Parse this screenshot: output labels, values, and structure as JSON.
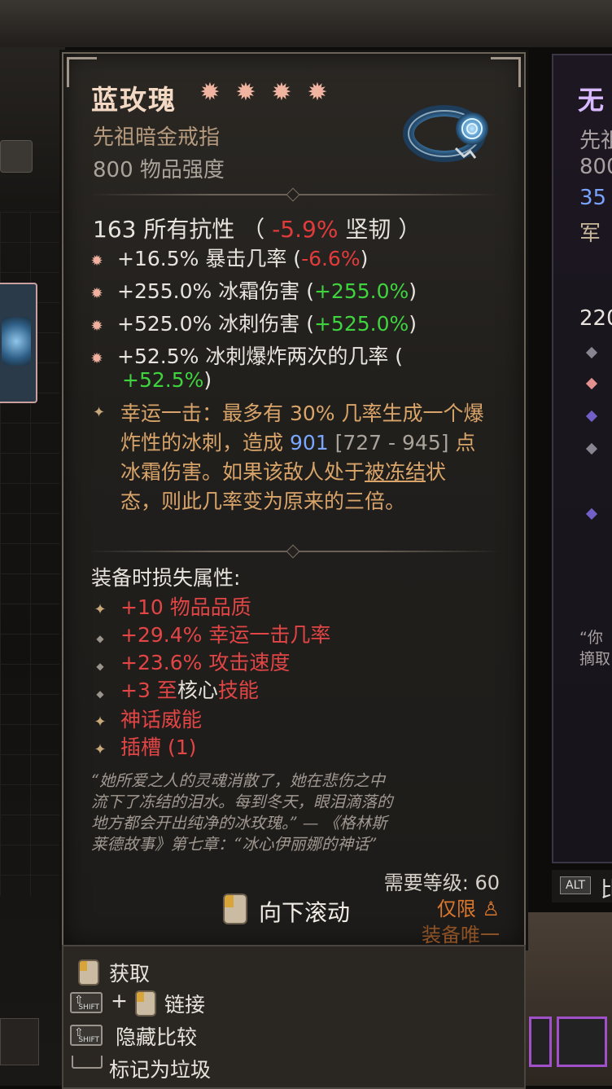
{
  "item": {
    "name": "蓝玫瑰",
    "type": "先祖暗金戒指",
    "power": "800 物品强度",
    "stars": [
      "star-icon",
      "star-icon",
      "star-icon",
      "star-icon"
    ]
  },
  "base_stat": {
    "value": "163 所有抗性",
    "open": "（",
    "delta": "-5.9%",
    "label": "坚韧",
    "close": "）"
  },
  "affixes": [
    {
      "value": "+16.5%",
      "label": "暴击几率",
      "cmp_open": "(",
      "cmp": "-6.6%",
      "cmp_close": ")"
    },
    {
      "value": "+255.0%",
      "label": "冰霜伤害",
      "cmp_open": "(",
      "cmp": "+255.0%",
      "cmp_close": ")"
    },
    {
      "value": "+525.0%",
      "label": "冰刺伤害",
      "cmp_open": "(",
      "cmp": "+525.0%",
      "cmp_close": ")"
    },
    {
      "value": "+52.5%",
      "label": "冰刺爆炸两次的几率",
      "cmp_open": "(",
      "cmp": "+52.5%",
      "cmp_close": ")"
    }
  ],
  "unique_power": {
    "part1": "幸运一击：最多有 30% 几率生成一个爆炸性的冰刺，造成 ",
    "damage": "901",
    "range": " [727 - 945] ",
    "part2": "点冰霜伤害。如果该敌人处于",
    "frozen": "被冻结",
    "part3": "状态，则此几率变为原来的三倍。"
  },
  "lost": {
    "title": "装备时损失属性:",
    "items": [
      {
        "text": "+10 物品品质"
      },
      {
        "text": "+29.4% 幸运一击几率"
      },
      {
        "text": "+23.6% 攻击速度"
      },
      {
        "prefix": "+3 至",
        "mid": "核心",
        "suffix": "技能"
      },
      {
        "text": "神话威能"
      },
      {
        "text": "插槽 (1)"
      }
    ]
  },
  "flavor": {
    "line1": "“她所爱之人的灵魂消散了，她在悲伤之中",
    "line2": "流下了冻结的泪水。每到冬天，眼泪滴落的",
    "line3": "地方都会开出纯净的冰玫瑰。” — 《格林斯",
    "line4": "莱德故事》第七章：“冰心伊丽娜的神话”"
  },
  "requirements": {
    "level": "需要等级: 60",
    "class_only": "仅限",
    "equip_unique": "装备唯一"
  },
  "scroll": {
    "label": "向下滚动"
  },
  "actions": {
    "acquire": "获取",
    "plus": "+",
    "link": "链接",
    "hide_compare": "隐藏比较",
    "mark_junk": "标记为垃圾",
    "shift": "SHIFT"
  },
  "compare_panel": {
    "title": "无",
    "type": "先祖",
    "power": "800",
    "extra": "35",
    "line1": "军",
    "stat": "220",
    "quote": "“你",
    "quote2": "摘取",
    "alt_key": "ALT",
    "alt_text": "比"
  },
  "colors": {
    "negative": "#e23b3b",
    "positive": "#3fd43f",
    "unique_power": "#d9a46a",
    "lost_red": "#e24545",
    "item_name": "#f3d8c4"
  }
}
